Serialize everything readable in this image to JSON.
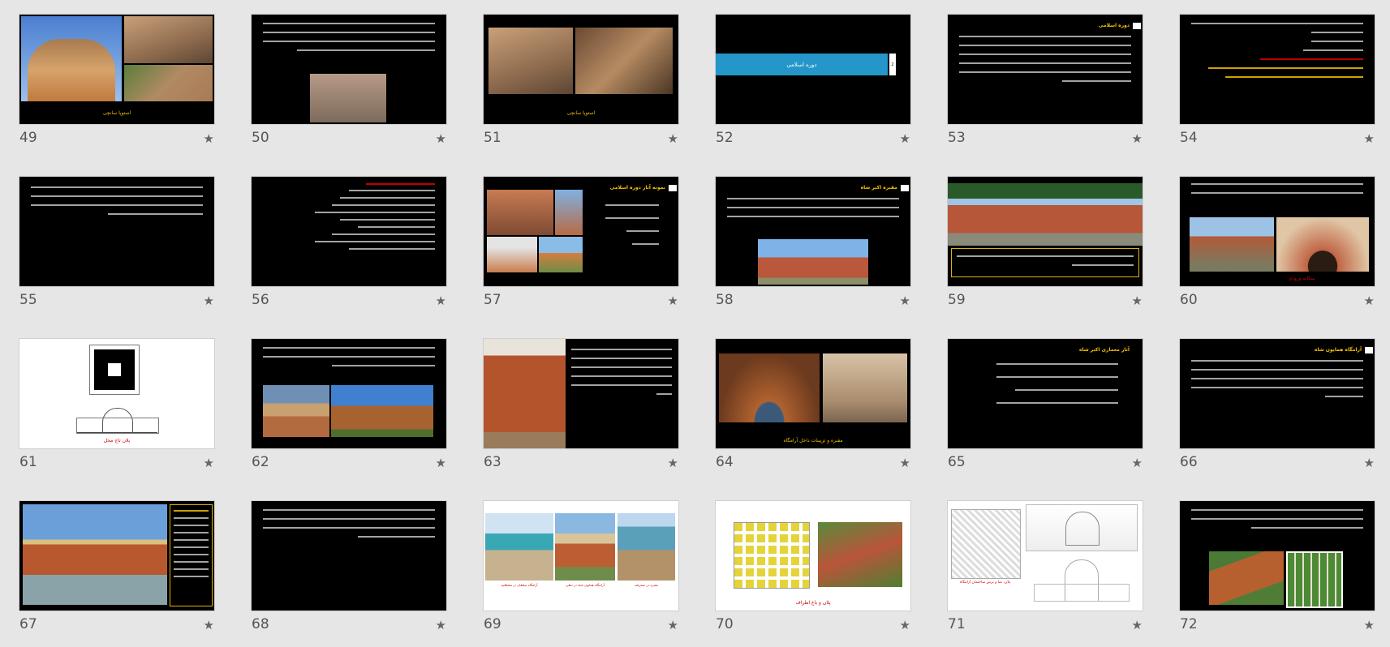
{
  "slides": [
    {
      "number": "49",
      "caption": "استوپا سانچی"
    },
    {
      "number": "50"
    },
    {
      "number": "51",
      "caption": "استوپا سانچی"
    },
    {
      "number": "52",
      "banner": "دوره اسلامی",
      "side_num": "2"
    },
    {
      "number": "53",
      "title": "دوره اسلامی"
    },
    {
      "number": "54"
    },
    {
      "number": "55"
    },
    {
      "number": "56"
    },
    {
      "number": "57",
      "title": "نمونه آثار دوره اسلامی"
    },
    {
      "number": "58",
      "title": "مقبره اکبر شاه"
    },
    {
      "number": "59"
    },
    {
      "number": "60",
      "caption": "سکانه ورودی"
    },
    {
      "number": "61",
      "caption": "پلان تاج محل"
    },
    {
      "number": "62"
    },
    {
      "number": "63"
    },
    {
      "number": "64",
      "caption": "مقبره و تزیینات داخل آرامگاه"
    },
    {
      "number": "65",
      "title": "آثار معماری اکبر شاه"
    },
    {
      "number": "66",
      "title": "آرامگاه همایون شاه"
    },
    {
      "number": "67"
    },
    {
      "number": "68"
    },
    {
      "number": "69",
      "captions": [
        "آرامگاه سلطان در سلطانیه",
        "آرامگاه همایون شاه در دهلی",
        "مقبره در سمرقند"
      ]
    },
    {
      "number": "70",
      "caption": "پلان و باغ اطراف"
    },
    {
      "number": "71",
      "caption": "پلان، نما و برش ساختمان آرامگاه"
    },
    {
      "number": "72"
    }
  ],
  "star_icon": "★"
}
